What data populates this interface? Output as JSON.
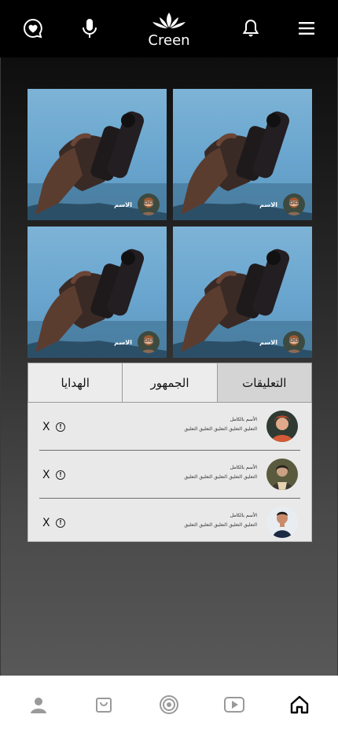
{
  "topbar": {
    "logo_text": "Creen",
    "icons": [
      "heart-chat-icon",
      "microphone-icon",
      "bell-icon",
      "menu-icon"
    ]
  },
  "streams": [
    {
      "name": "الاسم"
    },
    {
      "name": "الاسم"
    },
    {
      "name": "الاسم"
    },
    {
      "name": "الاسم"
    }
  ],
  "tabs": [
    {
      "label": "الهدايا"
    },
    {
      "label": "الجمهور"
    },
    {
      "label": "التعليقات"
    }
  ],
  "comments": [
    {
      "name": "الأسم بالكامل",
      "text": "التعليق التعليق التعليق التعليق التعليق",
      "close": "X",
      "info": "!"
    },
    {
      "name": "الأسم بالكامل",
      "text": "التعليق التعليق التعليق التعليق التعليق",
      "close": "X",
      "info": "!"
    },
    {
      "name": "الأسم بالكامل",
      "text": "التعليق التعليق التعليق التعليق التعليق",
      "close": "X",
      "info": "!"
    }
  ],
  "bottom_nav": [
    "profile-icon",
    "shopping-bag-icon",
    "target-icon",
    "video-play-icon",
    "home-icon"
  ],
  "colors": {
    "topbar": "#000000",
    "tab_active": "#d4d4d4",
    "panel": "#e9e9e9"
  }
}
